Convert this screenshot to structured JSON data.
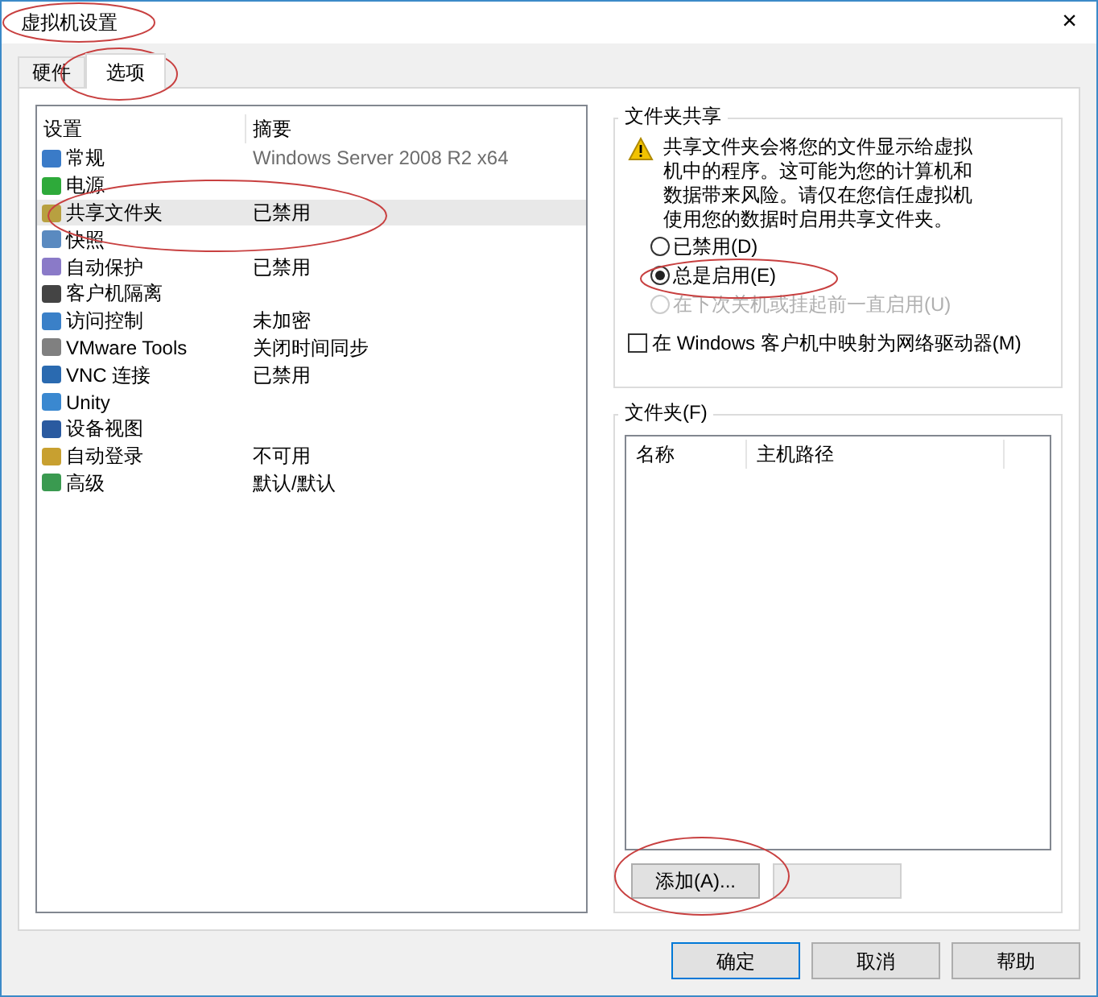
{
  "window": {
    "title": "虚拟机设置",
    "close": "×"
  },
  "tabs": [
    {
      "label": "硬件",
      "selected": false
    },
    {
      "label": "选项",
      "selected": true
    }
  ],
  "settings_list": {
    "columns": [
      "设置",
      "摘要"
    ],
    "rows": [
      {
        "name": "常规",
        "summary": "Windows Server 2008 R2 x64",
        "selected": false
      },
      {
        "name": "电源",
        "summary": "",
        "selected": false
      },
      {
        "name": "共享文件夹",
        "summary": "已禁用",
        "selected": true
      },
      {
        "name": "快照",
        "summary": "",
        "selected": false
      },
      {
        "name": "自动保护",
        "summary": "已禁用",
        "selected": false
      },
      {
        "name": "客户机隔离",
        "summary": "",
        "selected": false
      },
      {
        "name": "访问控制",
        "summary": "未加密",
        "selected": false
      },
      {
        "name": "VMware Tools",
        "summary": "关闭时间同步",
        "selected": false
      },
      {
        "name": "VNC 连接",
        "summary": "已禁用",
        "selected": false
      },
      {
        "name": "Unity",
        "summary": "",
        "selected": false
      },
      {
        "name": "设备视图",
        "summary": "",
        "selected": false
      },
      {
        "name": "自动登录",
        "summary": "不可用",
        "selected": false
      },
      {
        "name": "高级",
        "summary": "默认/默认",
        "selected": false
      }
    ]
  },
  "folder_sharing": {
    "title": "文件夹共享",
    "warning": "共享文件夹会将您的文件显示给虚拟机中的程序。这可能为您的计算机和数据带来风险。请仅在您信任虚拟机使用您的数据时启用共享文件夹。",
    "options": [
      {
        "label": "已禁用(D)",
        "selected": false,
        "disabled": false
      },
      {
        "label": "总是启用(E)",
        "selected": true,
        "disabled": false
      },
      {
        "label": "在下次关机或挂起前一直启用(U)",
        "selected": false,
        "disabled": true
      }
    ],
    "map_drive": {
      "label": "在 Windows 客户机中映射为网络驱动器(M)",
      "checked": false
    }
  },
  "folders": {
    "title": "文件夹(F)",
    "columns": [
      "名称",
      "主机路径"
    ],
    "add_button": "添加(A)...",
    "properties_button": {
      "disabled": true
    }
  },
  "buttons": [
    "确定",
    "取消",
    "帮助"
  ]
}
